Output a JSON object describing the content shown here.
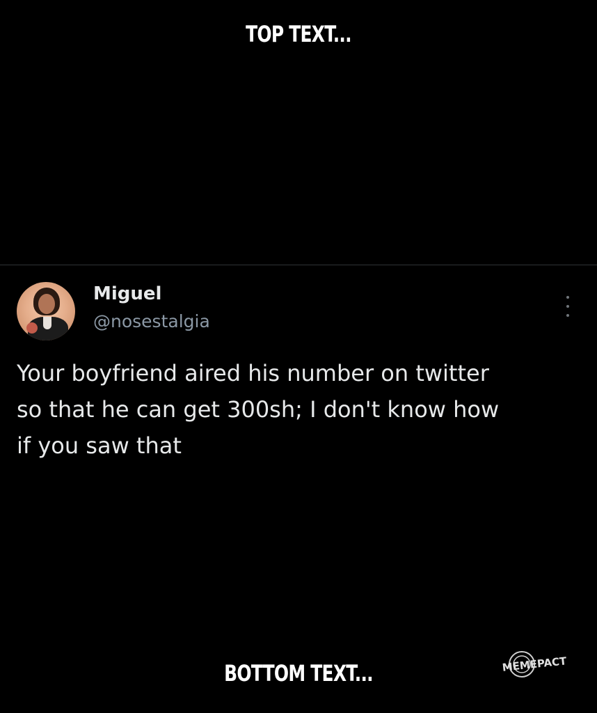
{
  "meme": {
    "top_caption": "TOP TEXT...",
    "bottom_caption": "BOTTOM TEXT..."
  },
  "tweet": {
    "author": {
      "display_name": "Miguel",
      "handle": "@nosestalgia",
      "avatar": "profile-photo"
    },
    "text": "Your boyfriend aired his number on twitter\nso that he can get 300sh; I don't know how\nif you saw that",
    "menu_icon": "more-vertical-icon"
  },
  "watermark": {
    "text": "MEMEPACT"
  },
  "colors": {
    "background": "#000000",
    "text_primary": "#e7e9ea",
    "text_secondary": "#8b98a5",
    "divider": "#2f3336"
  }
}
